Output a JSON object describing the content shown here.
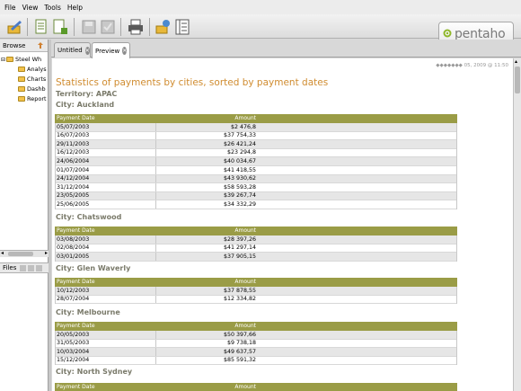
{
  "menu": [
    "File",
    "View",
    "Tools",
    "Help"
  ],
  "logo": {
    "text": "pentaho",
    "accent": "#8fb72a"
  },
  "browse": {
    "label": "Browse",
    "tree": [
      "Steel Wh",
      "Analys",
      "Charts",
      "Dashb",
      "Report"
    ]
  },
  "files": {
    "label": "Files"
  },
  "tabs": [
    {
      "label": "Untitled"
    },
    {
      "label": "Preview"
    }
  ],
  "report": {
    "meta": "◆◆◆◆◆◆◆ 05, 2009 @ 11:50",
    "title": "Statistics of payments by cities, sorted by payment dates",
    "territory": "Territory: APAC",
    "col_date": "Payment Date",
    "col_amount": "Amount",
    "cities": [
      {
        "name": "City: Auckland",
        "rows": [
          [
            "05/07/2003",
            "$2 476,8"
          ],
          [
            "16/07/2003",
            "$37 754,33"
          ],
          [
            "29/11/2003",
            "$26 421,24"
          ],
          [
            "16/12/2003",
            "$23 294,8"
          ],
          [
            "24/06/2004",
            "$40 034,67"
          ],
          [
            "01/07/2004",
            "$41 418,55"
          ],
          [
            "24/12/2004",
            "$43 930,62"
          ],
          [
            "31/12/2004",
            "$58 593,28"
          ],
          [
            "23/05/2005",
            "$39 267,74"
          ],
          [
            "25/06/2005",
            "$34 332,29"
          ]
        ]
      },
      {
        "name": "City: Chatswood",
        "rows": [
          [
            "03/08/2003",
            "$28 397,26"
          ],
          [
            "02/08/2004",
            "$41 297,14"
          ],
          [
            "03/01/2005",
            "$37 905,15"
          ]
        ]
      },
      {
        "name": "City: Glen Waverly",
        "rows": [
          [
            "10/12/2003",
            "$37 878,55"
          ],
          [
            "28/07/2004",
            "$12 334,82"
          ]
        ]
      },
      {
        "name": "City: Melbourne",
        "rows": [
          [
            "20/05/2003",
            "$50 397,66"
          ],
          [
            "31/05/2003",
            "$9 738,18"
          ],
          [
            "10/03/2004",
            "$49 637,57"
          ],
          [
            "15/12/2004",
            "$85 591,32"
          ]
        ]
      },
      {
        "name": "City: North Sydney",
        "rows": []
      }
    ]
  },
  "colors": {
    "title": "#d08c30",
    "header": "#9a9c46",
    "subhead": "#7a7a6a"
  }
}
